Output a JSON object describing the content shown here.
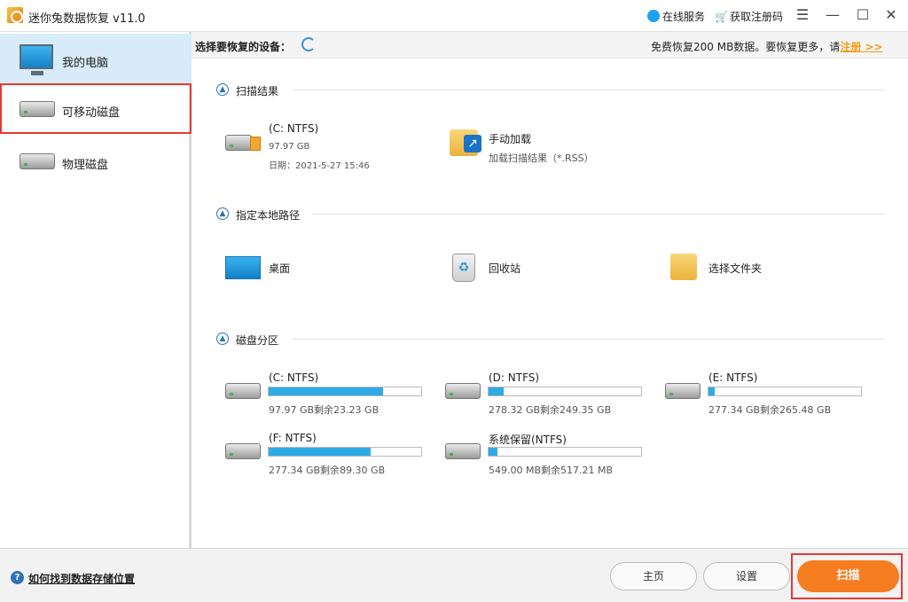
{
  "window": {
    "title": "迷你兔数据恢复 v11.0",
    "online_service": "在线服务",
    "get_code": "获取注册码"
  },
  "sidebar": {
    "items": [
      {
        "label": "我的电脑"
      },
      {
        "label": "可移动磁盘"
      },
      {
        "label": "物理磁盘"
      }
    ]
  },
  "topstrip": {
    "choose_device": "选择要恢复的设备：",
    "free_text": "免费恢复200 MB数据。要恢复更多，请",
    "register": "注册 >>"
  },
  "sections": {
    "scan_results": {
      "title": "扫描结果",
      "item": {
        "name": "(C: NTFS)",
        "size": "97.97 GB",
        "date": "日期：2021-5-27 15:46"
      },
      "manual": {
        "name": "手动加载",
        "desc": "加载扫描结果（*.RSS）"
      }
    },
    "local_path": {
      "title": "指定本地路径",
      "items": [
        {
          "label": "桌面"
        },
        {
          "label": "回收站"
        },
        {
          "label": "选择文件夹"
        }
      ]
    },
    "partitions": {
      "title": "磁盘分区",
      "items": [
        {
          "name": "(C: NTFS)",
          "usage": "97.97 GB剩余23.23 GB",
          "fill": 0.75
        },
        {
          "name": "(D: NTFS)",
          "usage": "278.32 GB剩余249.35 GB",
          "fill": 0.1
        },
        {
          "name": "(E: NTFS)",
          "usage": "277.34 GB剩余265.48 GB",
          "fill": 0.04
        },
        {
          "name": "(F: NTFS)",
          "usage": "277.34 GB剩余89.30 GB",
          "fill": 0.67
        },
        {
          "name": "系统保留(NTFS)",
          "usage": "549.00 MB剩余517.21 MB",
          "fill": 0.06
        }
      ]
    }
  },
  "bottom": {
    "help": "如何找到数据存储位置",
    "home": "主页",
    "settings": "设置",
    "scan": "扫描"
  },
  "colors": {
    "accent_orange": "#f57c1f",
    "bar_blue": "#2eaae6",
    "highlight_red": "#e53935",
    "register_orange": "#f39c12"
  }
}
